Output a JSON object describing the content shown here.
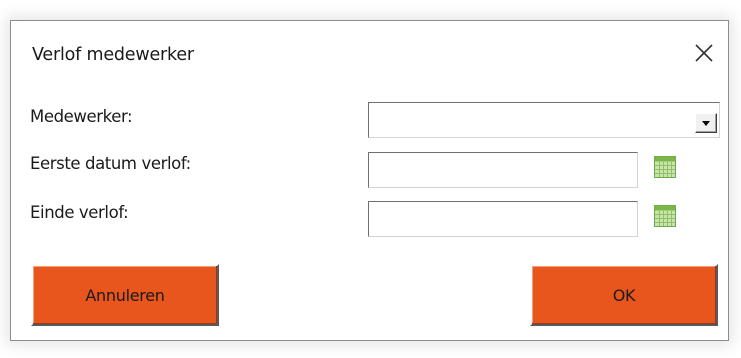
{
  "dialog": {
    "title": "Verlof medewerker",
    "close_icon": "close-icon"
  },
  "form": {
    "employee_label": "Medewerker:",
    "employee_value": "",
    "first_date_label": "Eerste datum verlof:",
    "first_date_value": "",
    "end_label": "Einde verlof:",
    "end_value": "",
    "calendar_icon": "calendar-icon"
  },
  "buttons": {
    "cancel_label": "Annuleren",
    "ok_label": "OK"
  },
  "colors": {
    "accent": "#e8561d",
    "calendar_icon": "#7ab648"
  }
}
